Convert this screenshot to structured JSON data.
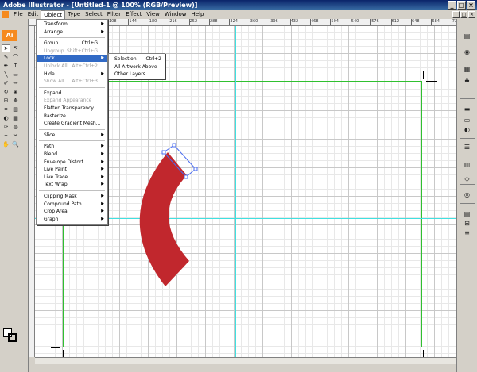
{
  "window": {
    "title": "Adobe Illustrator - [Untitled-1 @ 100% (RGB/Preview)]",
    "controls": [
      "_",
      "□",
      "×"
    ]
  },
  "menubar": {
    "items": [
      "File",
      "Edit",
      "Object",
      "Type",
      "Select",
      "Filter",
      "Effect",
      "View",
      "Window",
      "Help"
    ],
    "active": "Object"
  },
  "ruler": {
    "ticks": [
      "108",
      "144",
      "180",
      "216",
      "252",
      "288",
      "324",
      "360",
      "396",
      "432",
      "468",
      "504",
      "540",
      "576",
      "612",
      "648",
      "684",
      "720"
    ]
  },
  "toolbar": {
    "logo": "Ai",
    "tools": [
      "➤",
      "⇱",
      "✎",
      "⌒",
      "✒",
      "T",
      "╲",
      "▭",
      "✐",
      "✏",
      "↻",
      "◈",
      "⊞",
      "✥",
      "⌗",
      "▥",
      "◐",
      "▦",
      "✑",
      "◍",
      "⌖",
      "✂",
      "✋",
      "🔍"
    ]
  },
  "object_menu": {
    "items": [
      {
        "label": "Transform",
        "shortcut": "",
        "submenu": true,
        "disabled": false
      },
      {
        "label": "Arrange",
        "shortcut": "",
        "submenu": true,
        "disabled": false
      },
      {
        "label": "Group",
        "shortcut": "Ctrl+G",
        "submenu": false,
        "disabled": false
      },
      {
        "label": "Ungroup",
        "shortcut": "Shift+Ctrl+G",
        "submenu": false,
        "disabled": true
      },
      {
        "label": "Lock",
        "shortcut": "",
        "submenu": true,
        "disabled": false,
        "highlighted": true
      },
      {
        "label": "Unlock All",
        "shortcut": "Alt+Ctrl+2",
        "submenu": false,
        "disabled": true
      },
      {
        "label": "Hide",
        "shortcut": "",
        "submenu": true,
        "disabled": false
      },
      {
        "label": "Show All",
        "shortcut": "Alt+Ctrl+3",
        "submenu": false,
        "disabled": true
      },
      {
        "label": "Expand...",
        "shortcut": "",
        "submenu": false,
        "disabled": false
      },
      {
        "label": "Expand Appearance",
        "shortcut": "",
        "submenu": false,
        "disabled": true
      },
      {
        "label": "Flatten Transparency...",
        "shortcut": "",
        "submenu": false,
        "disabled": false
      },
      {
        "label": "Rasterize...",
        "shortcut": "",
        "submenu": false,
        "disabled": false
      },
      {
        "label": "Create Gradient Mesh...",
        "shortcut": "",
        "submenu": false,
        "disabled": false
      },
      {
        "label": "Slice",
        "shortcut": "",
        "submenu": true,
        "disabled": false
      },
      {
        "label": "Path",
        "shortcut": "",
        "submenu": true,
        "disabled": false
      },
      {
        "label": "Blend",
        "shortcut": "",
        "submenu": true,
        "disabled": false
      },
      {
        "label": "Envelope Distort",
        "shortcut": "",
        "submenu": true,
        "disabled": false
      },
      {
        "label": "Live Paint",
        "shortcut": "",
        "submenu": true,
        "disabled": false
      },
      {
        "label": "Live Trace",
        "shortcut": "",
        "submenu": true,
        "disabled": false
      },
      {
        "label": "Text Wrap",
        "shortcut": "",
        "submenu": true,
        "disabled": false
      },
      {
        "label": "Clipping Mask",
        "shortcut": "",
        "submenu": true,
        "disabled": false
      },
      {
        "label": "Compound Path",
        "shortcut": "",
        "submenu": true,
        "disabled": false
      },
      {
        "label": "Crop Area",
        "shortcut": "",
        "submenu": true,
        "disabled": false
      },
      {
        "label": "Graph",
        "shortcut": "",
        "submenu": true,
        "disabled": false
      }
    ]
  },
  "lock_submenu": {
    "items": [
      {
        "label": "Selection",
        "shortcut": "Ctrl+2"
      },
      {
        "label": "All Artwork Above",
        "shortcut": ""
      },
      {
        "label": "Other Layers",
        "shortcut": ""
      }
    ]
  },
  "artwork": {
    "arc_color": "#c1272d",
    "selection_color": "#4a6cf0",
    "artboard_color": "#30c030",
    "guide_color": "#40e0e0"
  },
  "right_panel": {
    "buttons": [
      "▤",
      "◉",
      "▦",
      "♣",
      "▬",
      "▭",
      "◐",
      "☰",
      "▥",
      "◇",
      "◎",
      "▤",
      "⊞",
      "≡"
    ]
  }
}
